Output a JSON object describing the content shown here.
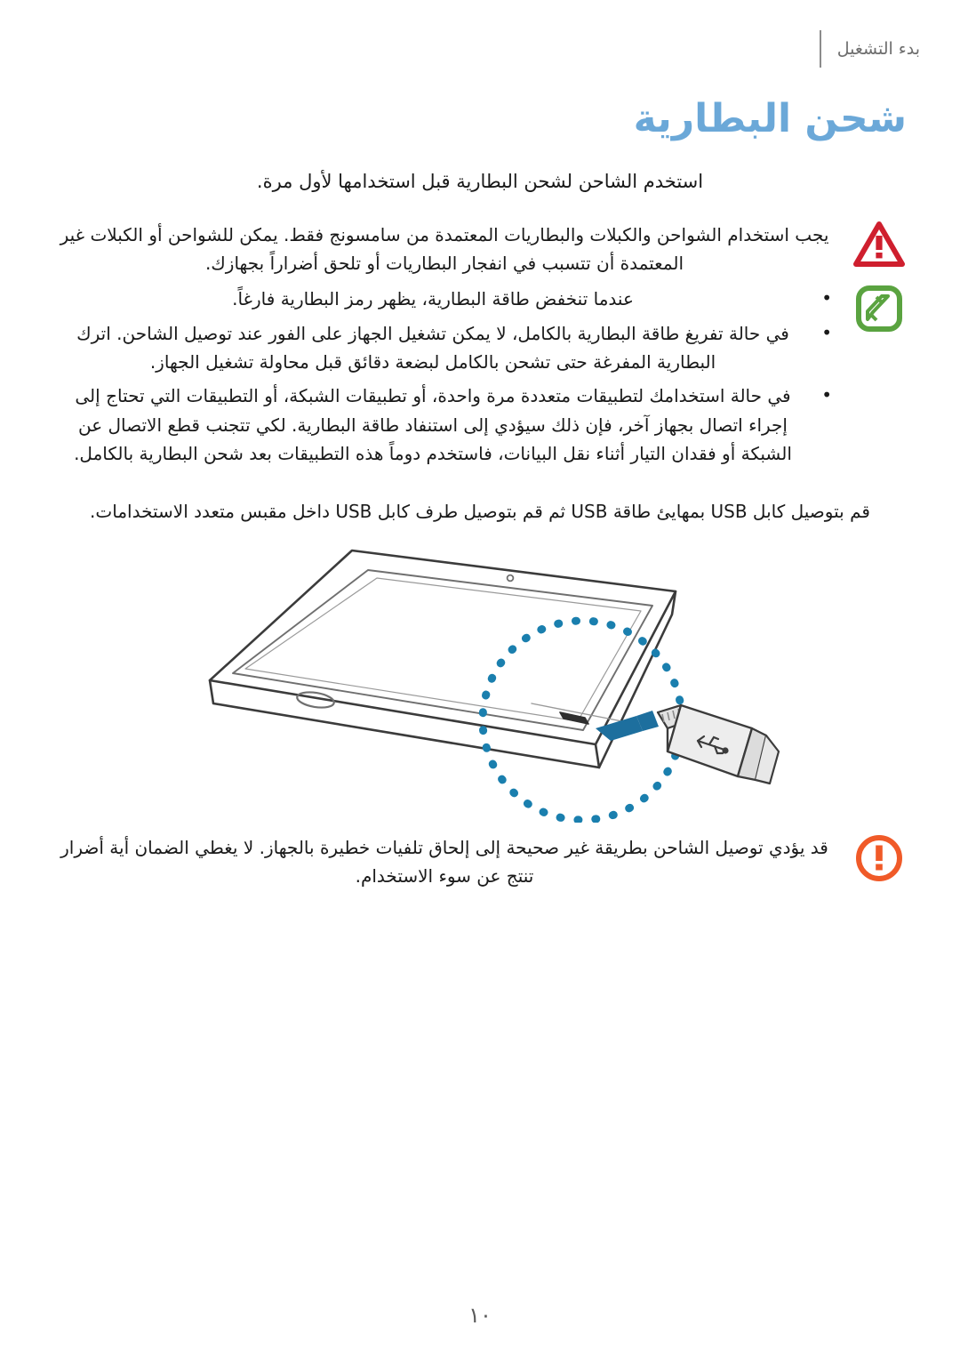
{
  "document": {
    "running_header": "بدء التشغيل",
    "page_number": "١٠"
  },
  "section": {
    "title": "شحن البطارية",
    "lead": "استخدم الشاحن لشحن البطارية قبل استخدامها لأول مرة."
  },
  "callouts": [
    {
      "icon": "warning-triangle-icon",
      "icon_color": "#cf1f2e",
      "text": "يجب استخدام الشواحن والكبلات والبطاريات المعتمدة من سامسونج فقط. يمكن للشواحن أو الكبلات غير المعتمدة أن تتسبب في انفجار البطاريات أو تلحق أضراراً بجهازك."
    },
    {
      "icon": "note-pencil-icon",
      "icon_color": "#5aa340",
      "bullets": [
        "عندما تنخفض طاقة البطارية، يظهر رمز البطارية فارغاً.",
        "في حالة تفريغ طاقة البطارية بالكامل، لا يمكن تشغيل الجهاز على الفور عند توصيل الشاحن. اترك البطارية المفرغة حتى تشحن بالكامل لبضعة دقائق قبل محاولة تشغيل الجهاز.",
        "في حالة استخدامك لتطبيقات متعددة مرة واحدة، أو تطبيقات الشبكة، أو التطبيقات التي تحتاج إلى إجراء اتصال بجهاز آخر، فإن ذلك سيؤدي إلى استنفاد طاقة البطارية. لكي تتجنب قطع الاتصال عن الشبكة أو فقدان التيار أثناء نقل البيانات، فاستخدم دوماً هذه التطبيقات بعد شحن البطارية بالكامل."
      ]
    }
  ],
  "instruction": {
    "usb_step": "قم بتوصيل كابل USB بمهايئ طاقة USB ثم قم بتوصيل طرف كابل USB داخل مقبس متعدد الاستخدامات."
  },
  "illustration": {
    "name": "tablet-usb-charging-illustration",
    "highlight_color": "#1a7fae",
    "connector_label": "usb-connector",
    "arrow_color": "#1d6f9e"
  },
  "bottom_caution": {
    "icon": "caution-circle-icon",
    "icon_color": "#f05a28",
    "text": "قد يؤدي توصيل الشاحن بطريقة غير صحيحة إلى إلحاق تلفيات خطيرة بالجهاز. لا يغطي الضمان أية أضرار تنتج عن سوء الاستخدام."
  }
}
